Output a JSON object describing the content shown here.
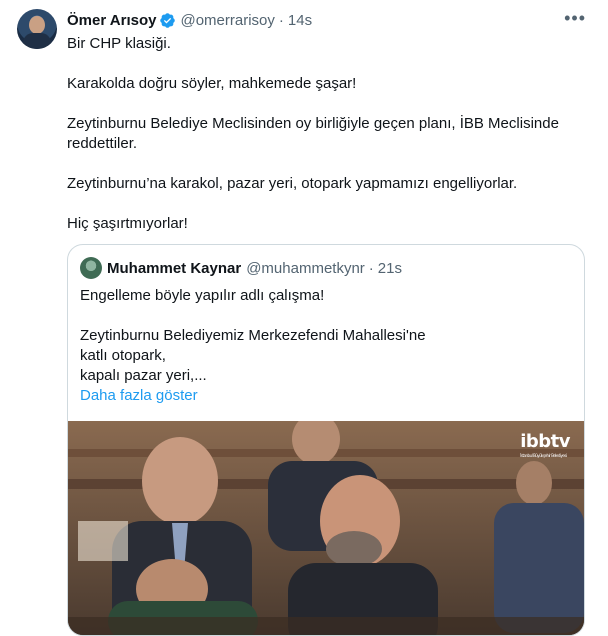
{
  "tweet": {
    "author_name": "Ömer Arısoy",
    "handle": "@omerrarisoy",
    "separator": "·",
    "time": "14s",
    "lines": [
      "Bir CHP klasiği.",
      "Karakolda doğru söyler, mahkemede şaşar!",
      "Zeytinburnu Belediye Meclisinden oy birliğiyle geçen planı, İBB Meclisinde reddettiler.",
      "Zeytinburnu’na karakol, pazar yeri, otopark yapmamızı engelliyorlar.",
      "Hiç şaşırtmıyorlar!"
    ],
    "more_icon": "more-horizontal-icon",
    "verified_icon": "verified-badge-icon"
  },
  "quote": {
    "author_name": "Muhammet Kaynar",
    "handle": "@muhammetkynr",
    "separator": "·",
    "time": "21s",
    "line1": "Engelleme böyle yapılır adlı çalışma!",
    "line2": "Zeytinburnu Belediyemiz Merkezefendi Mahallesi'ne",
    "line3": "katlı otopark,",
    "line4": "kapalı pazar yeri,...",
    "show_more": "Daha fazla göster",
    "media": {
      "watermark": "ibbtv",
      "watermark_sub": "İstanbul Büyükşehir Belediyesi"
    }
  },
  "colors": {
    "text": "#0f1419",
    "muted": "#536471",
    "link": "#1d9bf0",
    "border": "#cfd9de",
    "verified": "#1d9bf0"
  }
}
